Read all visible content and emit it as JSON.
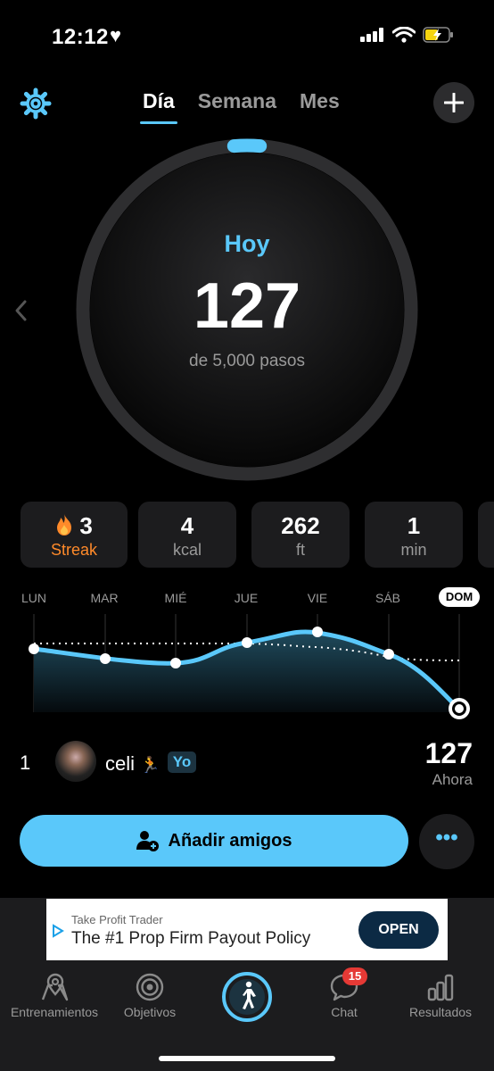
{
  "status": {
    "time": "12:12"
  },
  "nav": {
    "tabs": [
      "Día",
      "Semana",
      "Mes"
    ],
    "active_tab": "Día"
  },
  "ring": {
    "label": "Hoy",
    "steps": "127",
    "goal": "de 5,000 pasos",
    "progress": 0.0254
  },
  "stats": [
    {
      "value": "3",
      "label": "Streak",
      "icon": "fire-icon"
    },
    {
      "value": "4",
      "label": "kcal"
    },
    {
      "value": "262",
      "label": "ft"
    },
    {
      "value": "1",
      "label": "min"
    }
  ],
  "week": {
    "days": [
      "LUN",
      "MAR",
      "MIÉ",
      "JUE",
      "VIE",
      "SÁB",
      "DOM"
    ],
    "current_day": "DOM"
  },
  "leaderboard": {
    "rank": "1",
    "name": "celi",
    "you_badge": "Yo",
    "steps": "127",
    "time": "Ahora"
  },
  "actions": {
    "add_friends": "Añadir amigos"
  },
  "ad": {
    "advertiser": "Take Profit Trader",
    "headline": "The #1 Prop Firm Payout Policy",
    "cta": "OPEN"
  },
  "tabbar": {
    "items": [
      {
        "label": "Entrenamientos",
        "icon": "map-pin-icon"
      },
      {
        "label": "Objetivos",
        "icon": "target-icon"
      },
      {
        "label": "",
        "icon": "walking-icon"
      },
      {
        "label": "Chat",
        "icon": "chat-icon",
        "badge": "15"
      },
      {
        "label": "Resultados",
        "icon": "bar-chart-icon"
      }
    ]
  },
  "colors": {
    "accent": "#5ac8fa",
    "streak": "#ff8a2a",
    "badge": "#e53935",
    "card": "#1c1c1e"
  }
}
